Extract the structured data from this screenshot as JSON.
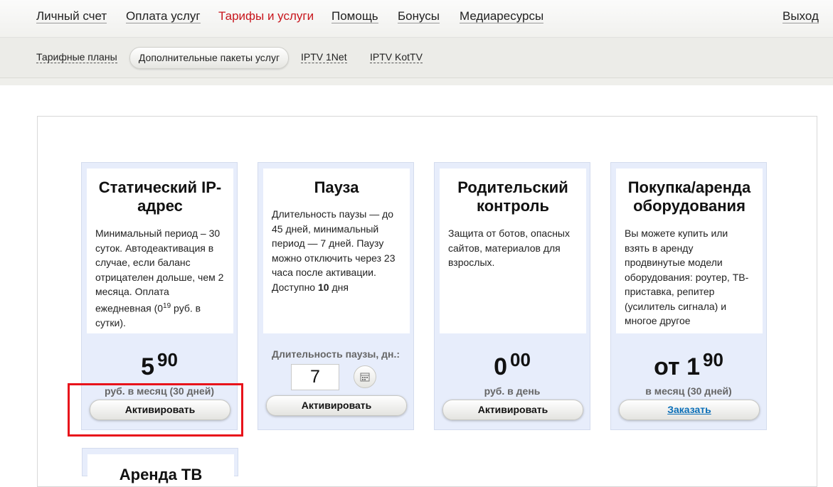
{
  "topnav": {
    "items": [
      "Личный счет",
      "Оплата услуг",
      "Тарифы и услуги",
      "Помощь",
      "Бонусы",
      "Медиаресурсы"
    ],
    "logout": "Выход"
  },
  "subnav": {
    "items": [
      "Тарифные планы",
      "Дополнительные пакеты услуг",
      "IPTV 1Net",
      "IPTV KotTV"
    ]
  },
  "cards": [
    {
      "title": "Статический IP-адрес",
      "desc_pre": "Минимальный период – 30 суток. Автодеактивация в случае, если баланс отрицателен дольше, чем 2 месяца. Оплата ежедневная (0",
      "desc_sup": "19",
      "desc_post": " руб. в сутки).",
      "price_main": "5",
      "price_sup": "90",
      "price_unit": "руб. в месяц (30 дней)",
      "button": "Активировать"
    },
    {
      "title": "Пауза",
      "desc_pre": "Длительность паузы — до 45 дней, минимальный период — 7 дней. Паузу можно отключить через 23 часа после активации. Доступно ",
      "desc_bold": "10",
      "desc_post": " дня",
      "duration_label": "Длительность паузы, дн.:",
      "duration_value": "7",
      "button": "Активировать"
    },
    {
      "title": "Родительский контроль",
      "desc": "Защита от ботов, опасных сайтов, материалов для взрослых.",
      "price_main": "0",
      "price_sup": "00",
      "price_unit": "руб. в день",
      "button": "Активировать"
    },
    {
      "title": "Покупка/аренда оборудования",
      "desc": "Вы можете купить или взять в аренду продвинутые модели оборудования: роутер, ТВ-приставка, репитер (усилитель сигнала) и многое другое",
      "price_main": "от 1",
      "price_sup": "90",
      "price_unit": "в месяц (30 дней)",
      "button": "Заказать"
    },
    {
      "title": "Аренда ТВ"
    }
  ],
  "colors": {
    "accent_red": "#c8161d",
    "highlight": "#e8131b",
    "card_bg": "#e7edfb",
    "link_blue": "#0b6fb8"
  }
}
